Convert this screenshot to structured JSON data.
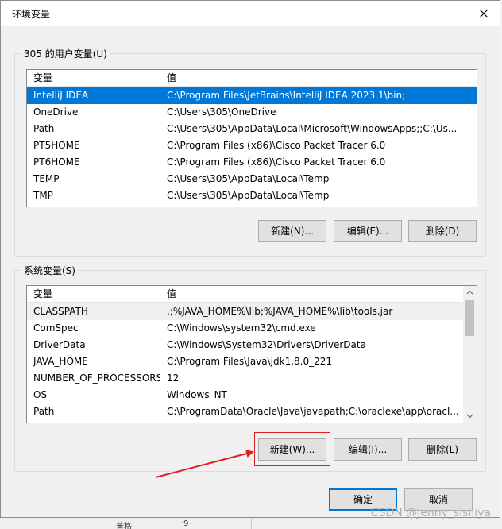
{
  "window": {
    "title": "环境变量",
    "close_icon": "close-icon"
  },
  "user_vars": {
    "group_label": "305 的用户变量(U)",
    "col_var": "变量",
    "col_val": "值",
    "rows": [
      {
        "name": "IntelliJ IDEA",
        "value": "C:\\Program Files\\JetBrains\\IntelliJ IDEA 2023.1\\bin;",
        "selected": true
      },
      {
        "name": "OneDrive",
        "value": "C:\\Users\\305\\OneDrive"
      },
      {
        "name": "Path",
        "value": "C:\\Users\\305\\AppData\\Local\\Microsoft\\WindowsApps;;C:\\Us..."
      },
      {
        "name": "PT5HOME",
        "value": "C:\\Program Files (x86)\\Cisco Packet Tracer 6.0"
      },
      {
        "name": "PT6HOME",
        "value": "C:\\Program Files (x86)\\Cisco Packet Tracer 6.0"
      },
      {
        "name": "TEMP",
        "value": "C:\\Users\\305\\AppData\\Local\\Temp"
      },
      {
        "name": "TMP",
        "value": "C:\\Users\\305\\AppData\\Local\\Temp"
      }
    ],
    "btn_new": "新建(N)...",
    "btn_edit": "编辑(E)...",
    "btn_delete": "删除(D)"
  },
  "system_vars": {
    "group_label": "系统变量(S)",
    "col_var": "变量",
    "col_val": "值",
    "rows": [
      {
        "name": "CLASSPATH",
        "value": ".;%JAVA_HOME%\\lib;%JAVA_HOME%\\lib\\tools.jar",
        "dim": true
      },
      {
        "name": "ComSpec",
        "value": "C:\\Windows\\system32\\cmd.exe"
      },
      {
        "name": "DriverData",
        "value": "C:\\Windows\\System32\\Drivers\\DriverData"
      },
      {
        "name": "JAVA_HOME",
        "value": "C:\\Program Files\\Java\\jdk1.8.0_221"
      },
      {
        "name": "NUMBER_OF_PROCESSORS",
        "value": "12"
      },
      {
        "name": "OS",
        "value": "Windows_NT"
      },
      {
        "name": "Path",
        "value": "C:\\ProgramData\\Oracle\\Java\\javapath;C:\\oraclexe\\app\\oracl..."
      }
    ],
    "btn_new": "新建(W)...",
    "btn_edit": "编辑(I)...",
    "btn_delete": "删除(L)"
  },
  "footer": {
    "ok": "确定",
    "cancel": "取消"
  },
  "annotation": {
    "color": "#e02020"
  },
  "watermark": "CSDN @Jenny_sisiliya",
  "background": {
    "bottom_left": "普格",
    "bottom_right": "·9",
    "edge_char": "a"
  },
  "colors": {
    "selection": "#0078d7",
    "dialog_bg": "#f0f0f0"
  }
}
